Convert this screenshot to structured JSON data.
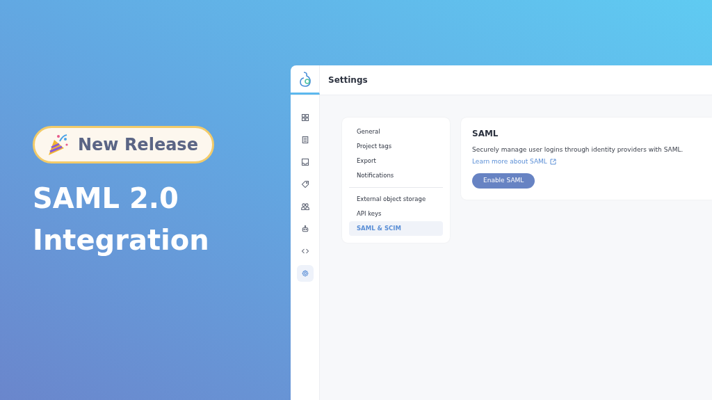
{
  "promo": {
    "badge": "New Release",
    "headline_lines": [
      "SAML 2.0",
      "Integration"
    ]
  },
  "app": {
    "header_title": "Settings",
    "sidebar": [
      {
        "kind": "grid",
        "selected": false
      },
      {
        "kind": "document",
        "selected": false
      },
      {
        "kind": "inbox",
        "selected": false
      },
      {
        "kind": "tag",
        "selected": false
      },
      {
        "kind": "users",
        "selected": false
      },
      {
        "kind": "robot",
        "selected": false
      },
      {
        "kind": "code",
        "selected": false
      },
      {
        "kind": "gear",
        "selected": true
      }
    ],
    "settings_nav": [
      [
        {
          "label": "General",
          "selected": false
        },
        {
          "label": "Project tags",
          "selected": false
        },
        {
          "label": "Export",
          "selected": false
        },
        {
          "label": "Notifications",
          "selected": false
        }
      ],
      [
        {
          "label": "External object storage",
          "selected": false
        },
        {
          "label": "API keys",
          "selected": false
        },
        {
          "label": "SAML & SCIM",
          "selected": true
        }
      ]
    ],
    "panel": {
      "title": "SAML",
      "description": "Securely manage user logins through identity providers with SAML.",
      "link": "Learn more about SAML",
      "button": "Enable SAML"
    }
  }
}
